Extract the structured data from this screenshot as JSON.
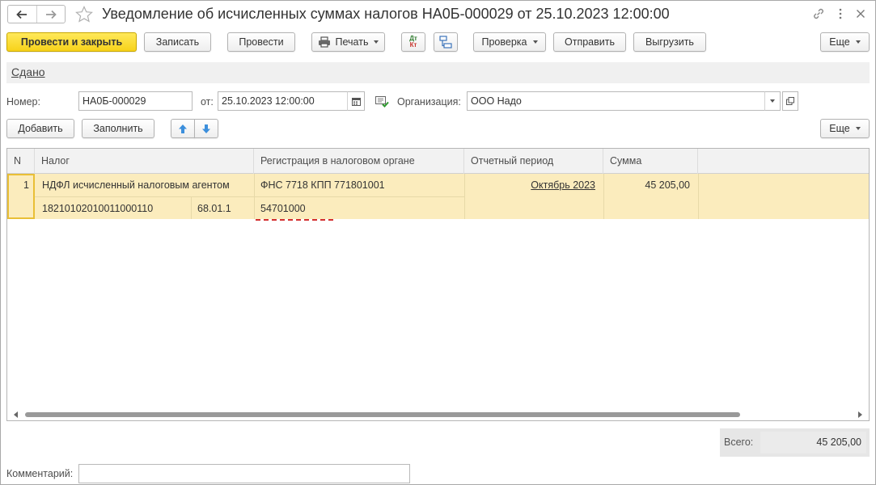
{
  "window": {
    "title": "Уведомление об исчисленных суммах налогов НА0Б-000029 от 25.10.2023 12:00:00",
    "back_icon": "arrow-left-icon",
    "forward_icon": "arrow-right-icon",
    "favorite_icon": "star-icon",
    "link_icon": "link-icon",
    "menu_icon": "more-vertical-icon",
    "close_icon": "close-icon"
  },
  "toolbar": {
    "post_close": "Провести и закрыть",
    "save": "Записать",
    "post": "Провести",
    "print": "Печать",
    "dt_kt_top": "Дт",
    "dt_kt_bottom": "Кт",
    "check": "Проверка",
    "send": "Отправить",
    "export": "Выгрузить",
    "more": "Еще"
  },
  "status": {
    "link": "Сдано"
  },
  "header": {
    "number_label": "Номер:",
    "number_value": "НА0Б-000029",
    "date_label": "от:",
    "date_value": "25.10.2023 12:00:00",
    "org_label": "Организация:",
    "org_value": "ООО Надо"
  },
  "table_toolbar": {
    "add": "Добавить",
    "fill": "Заполнить",
    "more": "Еще"
  },
  "table": {
    "columns": [
      "N",
      "Налог",
      "Регистрация в налоговом органе",
      "Отчетный период",
      "Сумма"
    ],
    "rows": [
      {
        "n": "1",
        "tax": "НДФЛ исчисленный налоговым агентом",
        "kbk": "18210102010011000110",
        "account": "68.01.1",
        "registration": "ФНС 7718 КПП 771801001",
        "oktmo": "54701000",
        "period": "Октябрь 2023",
        "amount": "45 205,00"
      }
    ]
  },
  "totals": {
    "label": "Всего:",
    "value": "45 205,00"
  },
  "comment": {
    "label": "Комментарий:",
    "value": ""
  },
  "colors": {
    "primary_button": "#f7d21a",
    "selected_row": "#fbecbd",
    "error_underline": "#d32f2f",
    "arrow_blue": "#3c8fdc"
  }
}
